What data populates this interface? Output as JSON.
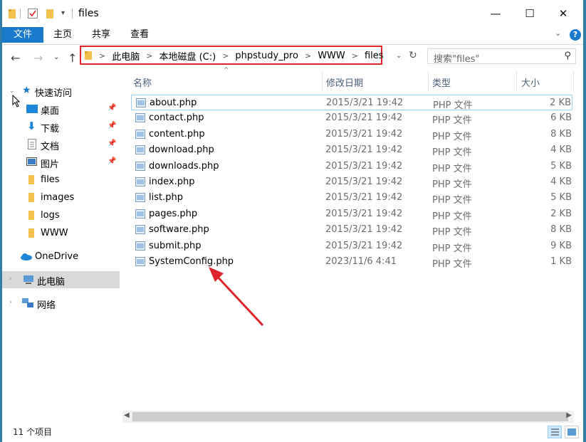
{
  "window": {
    "title": "files",
    "controls": {
      "minimize": "—",
      "maximize": "☐",
      "close": "✕"
    }
  },
  "ribbon": {
    "tabs": [
      "文件",
      "主页",
      "共享",
      "查看"
    ],
    "help": "?"
  },
  "address": {
    "crumbs": [
      "此电脑",
      "本地磁盘 (C:)",
      "phpstudy_pro",
      "WWW",
      "files"
    ],
    "search_placeholder": "搜索\"files\""
  },
  "columns": {
    "name": "名称",
    "date": "修改日期",
    "type": "类型",
    "size": "大小"
  },
  "nav": {
    "quick_access": "快速访问",
    "items": [
      "桌面",
      "下载",
      "文档",
      "图片",
      "files",
      "images",
      "logs",
      "WWW"
    ],
    "onedrive": "OneDrive",
    "this_pc": "此电脑",
    "network": "网络"
  },
  "files": [
    {
      "name": "about.php",
      "date": "2015/3/21 19:42",
      "type": "PHP 文件",
      "size": "2 KB"
    },
    {
      "name": "contact.php",
      "date": "2015/3/21 19:42",
      "type": "PHP 文件",
      "size": "6 KB"
    },
    {
      "name": "content.php",
      "date": "2015/3/21 19:42",
      "type": "PHP 文件",
      "size": "8 KB"
    },
    {
      "name": "download.php",
      "date": "2015/3/21 19:42",
      "type": "PHP 文件",
      "size": "4 KB"
    },
    {
      "name": "downloads.php",
      "date": "2015/3/21 19:42",
      "type": "PHP 文件",
      "size": "5 KB"
    },
    {
      "name": "index.php",
      "date": "2015/3/21 19:42",
      "type": "PHP 文件",
      "size": "4 KB"
    },
    {
      "name": "list.php",
      "date": "2015/3/21 19:42",
      "type": "PHP 文件",
      "size": "5 KB"
    },
    {
      "name": "pages.php",
      "date": "2015/3/21 19:42",
      "type": "PHP 文件",
      "size": "2 KB"
    },
    {
      "name": "software.php",
      "date": "2015/3/21 19:42",
      "type": "PHP 文件",
      "size": "8 KB"
    },
    {
      "name": "submit.php",
      "date": "2015/3/21 19:42",
      "type": "PHP 文件",
      "size": "9 KB"
    },
    {
      "name": "SystemConfig.php",
      "date": "2023/11/6 4:41",
      "type": "PHP 文件",
      "size": "1 KB"
    }
  ],
  "status": {
    "count": "11 个项目"
  },
  "colors": {
    "accent": "#1979ca",
    "annotation": "#e0242b",
    "folder": "#f2c14e"
  }
}
